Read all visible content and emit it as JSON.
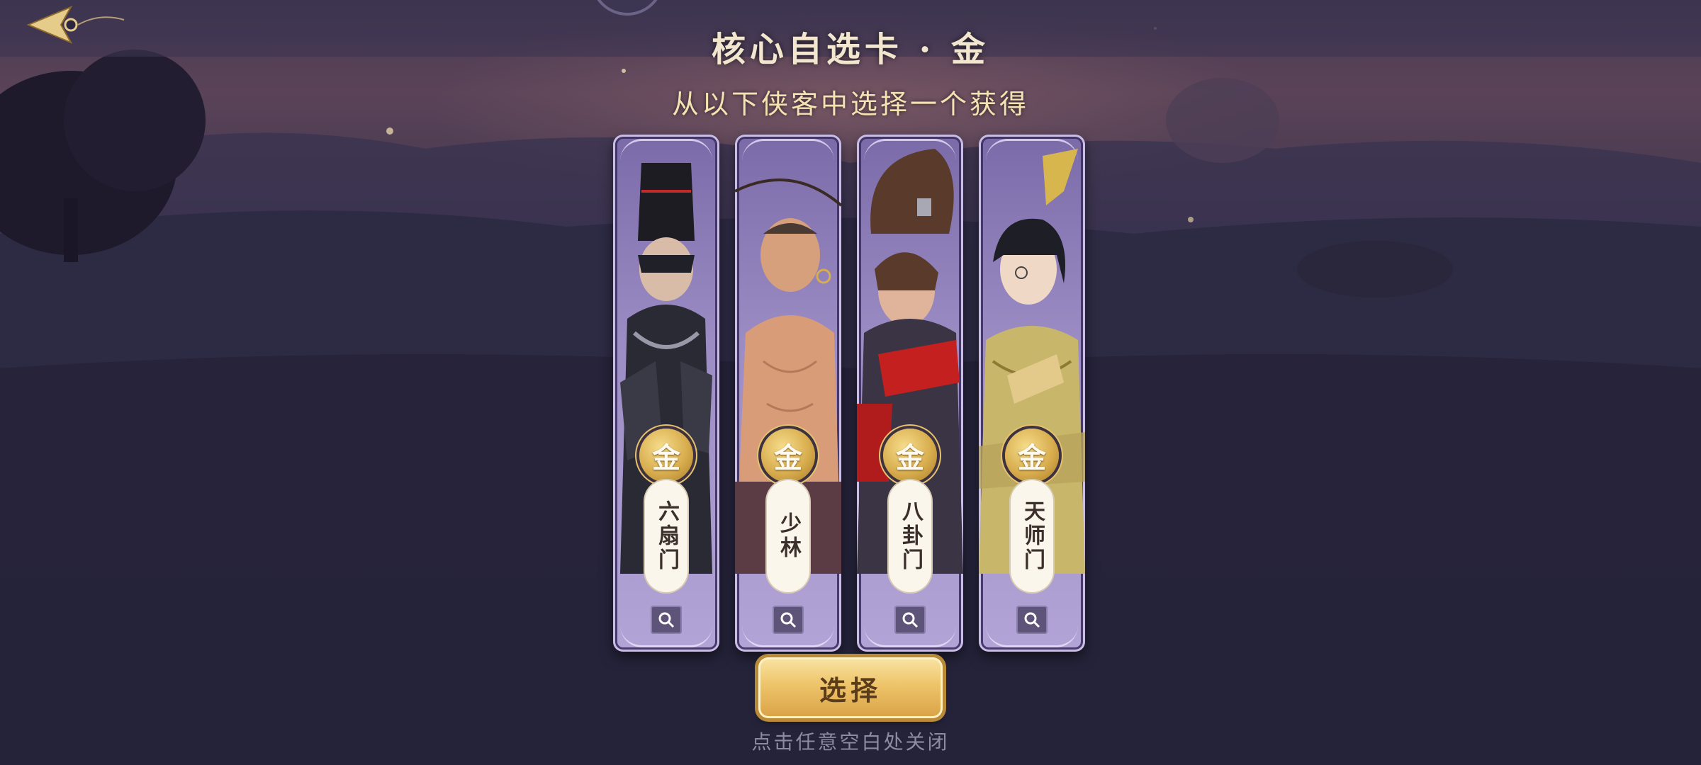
{
  "header": {
    "back_icon": "back-arrow-icon"
  },
  "dialog": {
    "title": "核心自选卡 · 金",
    "subtitle": "从以下侠客中选择一个获得",
    "cards": [
      {
        "tier": "金",
        "sect": "六扇门",
        "icon": "magnifier-icon",
        "portrait": "black-armored-hero"
      },
      {
        "tier": "金",
        "sect": "少林",
        "icon": "magnifier-icon",
        "portrait": "shaolin-monk"
      },
      {
        "tier": "金",
        "sect": "八卦门",
        "icon": "magnifier-icon",
        "portrait": "ponytail-swordsman"
      },
      {
        "tier": "金",
        "sect": "天师门",
        "icon": "magnifier-icon",
        "portrait": "golden-robed-taoist"
      }
    ],
    "choose_label": "选择",
    "close_hint": "点击任意空白处关闭"
  },
  "colors": {
    "card_purple": "#9c8cc4",
    "gold": "#d8ad4e",
    "title_text": "#f2e6cf",
    "hint_text": "#8f8aa3"
  }
}
